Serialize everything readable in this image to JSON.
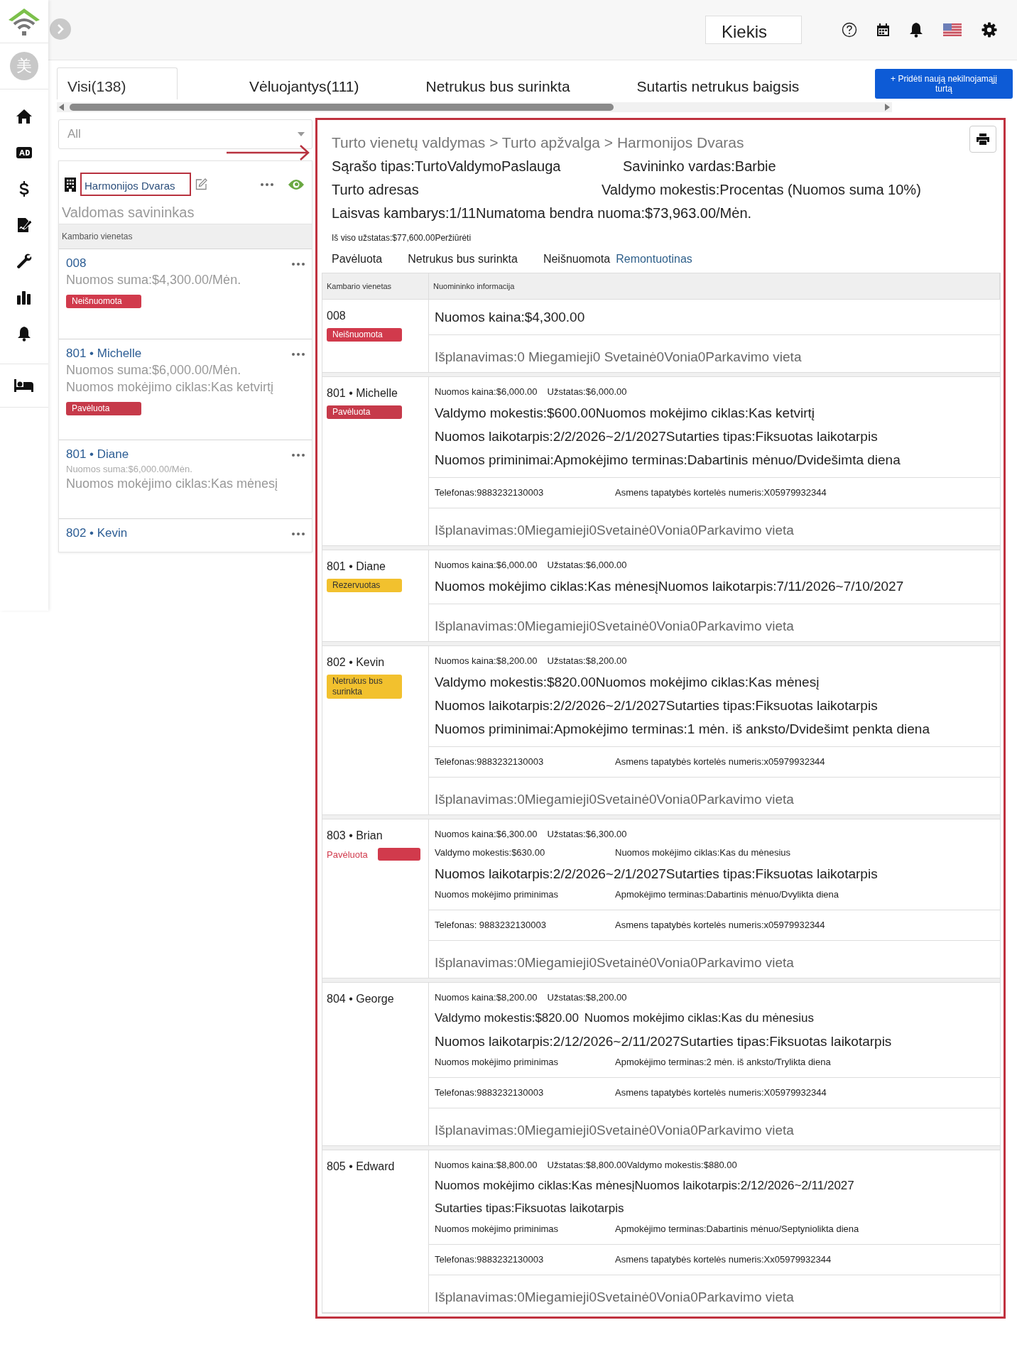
{
  "rail": {
    "avatar": "美"
  },
  "topbar": {
    "quantity_field": {
      "value": "Kiekis"
    }
  },
  "tabs": [
    {
      "label": "Visi(138)",
      "selected": true
    },
    {
      "label": "Vėluojantys(111)",
      "selected": false
    },
    {
      "label": "Netrukus bus surinkta",
      "selected": false
    },
    {
      "label": "Sutartis netrukus baigsis",
      "selected": false
    }
  ],
  "add_button": "+ Pridėti naują nekilnojamąjį turtą",
  "filter": {
    "value": "All"
  },
  "property": {
    "name": "Harmonijos Dvaras",
    "highlighted": true,
    "annotation_arrow": true,
    "subtitle": "Valdomas savininkas",
    "list_header": "Kambario vienetas",
    "units": [
      {
        "title": "008",
        "lines": [
          {
            "kind": "major",
            "text": "Nuomos suma:$4,300.00/Mėn."
          }
        ],
        "badge": {
          "label": "Neišnuomota",
          "color": "#d13a4c",
          "kind": "filled"
        }
      },
      {
        "title": "801 • Michelle",
        "lines": [
          {
            "kind": "major",
            "text": "Nuomos suma:$6,000.00/Mėn."
          },
          {
            "kind": "major",
            "text": "Nuomos mokėjimo ciklas:Kas ketvirtį"
          }
        ],
        "badge": {
          "label": "Pavėluota",
          "color": "#c63a4a",
          "kind": "filled"
        }
      },
      {
        "title": "801 • Diane",
        "lines": [
          {
            "kind": "minor",
            "text": "Nuomos suma:$6,000.00/Mėn."
          },
          {
            "kind": "major",
            "text": "Nuomos mokėjimo ciklas:Kas mėnesį"
          }
        ]
      },
      {
        "title": "802 • Kevin"
      }
    ]
  },
  "detail": {
    "highlighted": true,
    "breadcrumb": "Turto vienetų valdymas > Turto apžvalga > Harmonijos Dvaras",
    "info_rows": [
      [
        "Sąrašo tipas:TurtoValdymoPaslauga",
        "Savininko vardas:Barbie"
      ],
      [
        "Turto adresas",
        "Valdymo mokestis:Procentas (Nuomos suma 10%)"
      ],
      [
        "Laisvas kambarys:1/11Numatoma bendra nuoma:$73,963.00/Mėn."
      ]
    ],
    "total_deposit": "Iš viso užstatas:$77,600.00Peržiūrėti",
    "filters": [
      {
        "label": "Pavėluota",
        "selected": false
      },
      {
        "label": "Netrukus bus surinkta",
        "selected": false
      },
      {
        "label": "Neišnuomota",
        "selected": false
      },
      {
        "label": "Remontuotinas",
        "selected": true
      }
    ],
    "columns": [
      "Kambario vienetas",
      "Nuomininko informacija"
    ],
    "rows": [
      {
        "unit": "008",
        "badge": {
          "label": "Neišnuomota",
          "color": "#d13a4c",
          "kind": "filled"
        },
        "sections": [
          [
            {
              "kind": "major",
              "items": [
                "Nuomos kaina:$4,300.00"
              ]
            }
          ],
          [
            {
              "kind": "layout",
              "items": [
                "Išplanavimas:0 Miegamieji0 Svetainė0Vonia0Parkavimo vieta"
              ]
            }
          ]
        ]
      },
      {
        "unit": "801 • Michelle",
        "badge": {
          "label": "Pavėluota",
          "color": "#c63a4a",
          "kind": "filled"
        },
        "sections": [
          [
            {
              "kind": "minor",
              "items": [
                "Nuomos kaina:$6,000.00",
                "Užstatas:$6,000.00"
              ]
            },
            {
              "kind": "major",
              "items": [
                "Valdymo mokestis:$600.00Nuomos mokėjimo ciklas:Kas ketvirtį"
              ]
            },
            {
              "kind": "major",
              "items": [
                "Nuomos laikotarpis:2/2/2026~2/1/2027Sutarties tipas:Fiksuotas laikotarpis"
              ]
            },
            {
              "kind": "major",
              "items": [
                "Nuomos priminimai:Apmokėjimo terminas:Dabartinis mėnuo/Dvidešimta diena"
              ]
            }
          ],
          [
            {
              "kind": "split",
              "items": [
                "Telefonas:9883232130003",
                "Asmens tapatybės kortelės numeris:X05979932344"
              ]
            }
          ],
          [
            {
              "kind": "layout",
              "items": [
                "Išplanavimas:0Miegamieji0Svetainė0Vonia0Parkavimo vieta"
              ]
            }
          ]
        ]
      },
      {
        "unit": "801 • Diane",
        "badge": {
          "label": "Rezervuotas",
          "color": "#f2c12e",
          "kind": "filled"
        },
        "sections": [
          [
            {
              "kind": "minor",
              "items": [
                "Nuomos kaina:$6,000.00",
                "Užstatas:$6,000.00"
              ]
            },
            {
              "kind": "major",
              "items": [
                "Nuomos mokėjimo ciklas:Kas mėnesįNuomos laikotarpis:7/11/2026~7/10/2027"
              ]
            }
          ],
          [
            {
              "kind": "layout",
              "items": [
                "Išplanavimas:0Miegamieji0Svetainė0Vonia0Parkavimo vieta"
              ]
            }
          ]
        ]
      },
      {
        "unit": "802 • Kevin",
        "badge": {
          "label": "Netrukus bus surinkta",
          "color": "#f2c12e",
          "kind": "filled"
        },
        "sections": [
          [
            {
              "kind": "minor",
              "items": [
                "Nuomos kaina:$8,200.00",
                "Užstatas:$8,200.00"
              ]
            },
            {
              "kind": "major",
              "items": [
                "Valdymo mokestis:$820.00Nuomos mokėjimo ciklas:Kas mėnesį"
              ]
            },
            {
              "kind": "major",
              "items": [
                "Nuomos laikotarpis:2/2/2026~2/1/2027Sutarties tipas:Fiksuotas laikotarpis"
              ]
            },
            {
              "kind": "major",
              "items": [
                "Nuomos priminimai:Apmokėjimo terminas:1 mėn. iš anksto/Dvidešimt penkta diena"
              ]
            }
          ],
          [
            {
              "kind": "split",
              "items": [
                "Telefonas:9883232130003",
                "Asmens tapatybės kortelės numeris:x05979932344"
              ]
            }
          ],
          [
            {
              "kind": "layout",
              "items": [
                "Išplanavimas:0Miegamieji0Svetainė0Vonia0Parkavimo vieta"
              ]
            }
          ]
        ]
      },
      {
        "unit": "803 • Brian",
        "badge": {
          "label": "Pavėluota",
          "color": "#d13a4c",
          "kind": "outside"
        },
        "sections": [
          [
            {
              "kind": "minor",
              "items": [
                "Nuomos kaina:$6,300.00",
                "Užstatas:$6,300.00"
              ]
            },
            {
              "kind": "split",
              "items": [
                "Valdymo mokestis:$630.00",
                "Nuomos mokėjimo ciklas:Kas du mėnesius"
              ]
            },
            {
              "kind": "major",
              "items": [
                "Nuomos laikotarpis:2/2/2026~2/1/2027Sutarties tipas:Fiksuotas laikotarpis"
              ]
            },
            {
              "kind": "split",
              "items": [
                "Nuomos mokėjimo priminimas",
                "Apmokėjimo terminas:Dabartinis mėnuo/Dvylikta diena"
              ]
            }
          ],
          [
            {
              "kind": "split",
              "items": [
                "Telefonas: 9883232130003",
                "Asmens tapatybės kortelės numeris:x05979932344"
              ]
            }
          ],
          [
            {
              "kind": "layout",
              "items": [
                "Išplanavimas:0Miegamieji0Svetainė0Vonia0Parkavimo vieta"
              ]
            }
          ]
        ]
      },
      {
        "unit": "804 • George",
        "sections": [
          [
            {
              "kind": "minor",
              "items": [
                "Nuomos kaina:$8,200.00",
                "Užstatas:$8,200.00"
              ]
            },
            {
              "kind": "medium",
              "items": [
                "Valdymo mokestis:$820.00",
                "Nuomos mokėjimo ciklas:Kas du mėnesius"
              ]
            },
            {
              "kind": "major",
              "items": [
                "Nuomos laikotarpis:2/12/2026~2/11/2027Sutarties tipas:Fiksuotas laikotarpis"
              ]
            },
            {
              "kind": "split",
              "items": [
                "Nuomos mokėjimo priminimas",
                "Apmokėjimo terminas:2 mėn. iš anksto/Trylikta diena"
              ]
            }
          ],
          [
            {
              "kind": "split",
              "items": [
                "Telefonas:9883232130003",
                "Asmens tapatybės kortelės numeris:X05979932344"
              ]
            }
          ],
          [
            {
              "kind": "layout",
              "items": [
                "Išplanavimas:0Miegamieji0Svetainė0Vonia0Parkavimo vieta"
              ]
            }
          ]
        ]
      },
      {
        "unit": "805 • Edward",
        "sections": [
          [
            {
              "kind": "minor",
              "items": [
                "Nuomos kaina:$8,800.00",
                "Užstatas:$8,800.00Valdymo mokestis:$880.00"
              ]
            },
            {
              "kind": "medium",
              "items": [
                "Nuomos mokėjimo ciklas:Kas mėnesįNuomos laikotarpis:2/12/2026~2/11/2027"
              ]
            },
            {
              "kind": "medium",
              "items": [
                "Sutarties tipas:Fiksuotas laikotarpis"
              ]
            },
            {
              "kind": "split",
              "items": [
                "Nuomos mokėjimo priminimas",
                "Apmokėjimo terminas:Dabartinis mėnuo/Septyniolikta diena"
              ]
            }
          ],
          [
            {
              "kind": "split",
              "items": [
                "Telefonas:9883232130003",
                "Asmens tapatybės kortelės numeris:Xx05979932344"
              ]
            }
          ],
          [
            {
              "kind": "layout",
              "items": [
                "Išplanavimas:0Miegamieji0Svetainė0Vonia0Parkavimo vieta"
              ]
            }
          ]
        ]
      }
    ]
  }
}
